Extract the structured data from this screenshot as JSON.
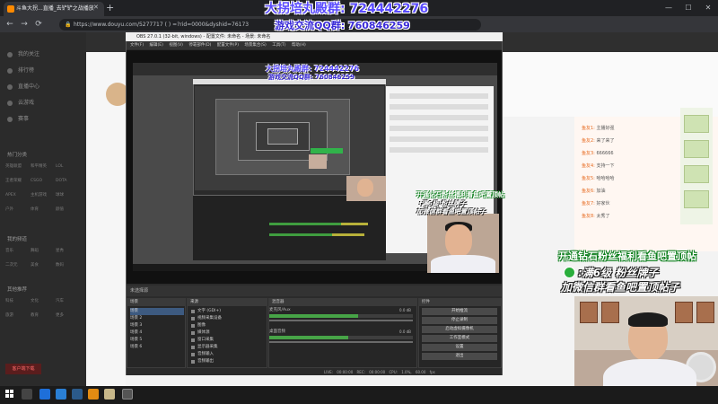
{
  "browser": {
    "tab_title": "斗鱼大拐...直播_去铲铲之战播放",
    "new_tab_glyph": "+",
    "address": "https://www.douyu.com/5277717 ( ) =?rid=0000&dyshid=76173",
    "controls": {
      "minimize": "—",
      "maximize": "☐",
      "close": "✕"
    },
    "nav": {
      "back": "←",
      "forward": "→",
      "reload": "⟳"
    }
  },
  "overlay": {
    "qq_group": "大拐培丸殿群: 724442276",
    "game_qq": "游戏交流QQ群: 760846259",
    "promo_green": "开通钻石粉丝福利看鱼吧置顶帖",
    "promo_wechat": ":满6级 粉丝牌子",
    "promo_wechat2": "加微信群看鱼吧置顶帖子"
  },
  "site": {
    "left_nav": [
      "我的关注",
      "排行榜",
      "直播中心",
      "云游戏",
      "赛事"
    ],
    "section_hot": "热门分类",
    "hot_grid": [
      "英雄联盟",
      "和平精英",
      "LOL",
      "王者荣耀",
      "CSGO",
      "DOTA",
      "APEX",
      "主机游戏",
      "球球",
      "户外",
      "体育",
      "颜值"
    ],
    "section_fav": "我的频道",
    "fav_grid": [
      "音乐",
      "舞蹈",
      "星秀",
      "二次元",
      "美食",
      "数码"
    ],
    "section_more": "其他推荐",
    "more_grid": [
      "科技",
      "文化",
      "汽车",
      "旅游",
      "教育",
      "更多"
    ],
    "red_button": "客户端下载",
    "chat": [
      {
        "user": "鱼友1:",
        "text": "主播好强"
      },
      {
        "user": "鱼友2:",
        "text": "来了来了"
      },
      {
        "user": "鱼友3:",
        "text": "666666"
      },
      {
        "user": "鱼友4:",
        "text": "支持一下"
      },
      {
        "user": "鱼友5:",
        "text": "哈哈哈哈"
      },
      {
        "user": "鱼友6:",
        "text": "加油"
      },
      {
        "user": "鱼友7:",
        "text": "好家伙"
      },
      {
        "user": "鱼友8:",
        "text": "太秀了"
      }
    ]
  },
  "obs": {
    "title": "OBS 27.0.1 (32-bit, windows) - 配置文件: 未命名 - 场景: 未命名",
    "menu": "文件(F) 编辑(E) 视图(V) 停靠部件(D) 配置文件(P) 场景集合(S) 工具(T) 帮助(H)",
    "scene_bar": "未选择源",
    "docks": {
      "scenes": "场景",
      "sources": "来源",
      "mixer": "混音器",
      "controls": "控件"
    },
    "scenes": [
      "场景",
      "场景 2",
      "场景 3",
      "场景 4",
      "场景 5",
      "场景 6"
    ],
    "sources": [
      "文字 (GDI+)",
      "视频采集设备",
      "图像",
      "媒体源",
      "窗口采集",
      "显示器采集",
      "音频输入",
      "音频输出"
    ],
    "mixer": [
      {
        "label": "麦克风/Aux",
        "db": "0.0 dB",
        "level": 0.62
      },
      {
        "label": "桌面音频",
        "db": "0.0 dB",
        "level": 0.55
      }
    ],
    "controls": [
      "开始推流",
      "停止录制",
      "启动虚拟摄像机",
      "工作室模式",
      "设置",
      "退出"
    ],
    "status": "LIVE: 00:00:00 REC: 00:00:00 CPU: 1.0%, 60.00 fps"
  },
  "colors": {
    "obs_bg": "#2b2b2b",
    "accent_green": "#47a447",
    "qq_blue": "#5a4bff"
  }
}
